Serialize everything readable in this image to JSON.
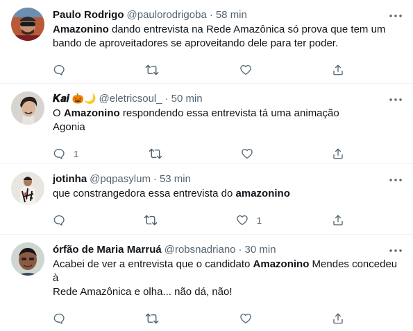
{
  "tweets": [
    {
      "name": "Paulo Rodrigo",
      "handle": "@paulorodrigoba",
      "separator": "·",
      "time": "58 min",
      "text_lines": [
        [
          {
            "t": "Amazonino",
            "b": true
          },
          {
            "t": " dando entrevista na Rede Amazônica só prova que tem um",
            "b": false
          }
        ],
        [
          {
            "t": "bando de aproveitadores se aproveitando dele para ter poder.",
            "b": false
          }
        ]
      ],
      "reply_count": "",
      "retweet_count": "",
      "like_count": ""
    },
    {
      "name": "𝑲𝒂𝒊",
      "name_emoji": "🎃🌙",
      "handle": "@eletricsoul_",
      "separator": "·",
      "time": "50 min",
      "text_lines": [
        [
          {
            "t": "O ",
            "b": false
          },
          {
            "t": "Amazonino",
            "b": true
          },
          {
            "t": " respondendo essa entrevista tá uma animação",
            "b": false
          }
        ],
        [
          {
            "t": "Agonia",
            "b": false
          }
        ]
      ],
      "reply_count": "1",
      "retweet_count": "",
      "like_count": ""
    },
    {
      "name": "jotinha",
      "handle": "@pqpasylum",
      "separator": "·",
      "time": "53 min",
      "text_lines": [
        [
          {
            "t": "que constrangedora essa entrevista do ",
            "b": false
          },
          {
            "t": "amazonino",
            "b": true
          }
        ]
      ],
      "reply_count": "",
      "retweet_count": "",
      "like_count": "1"
    },
    {
      "name": "órfão de Maria Marruá",
      "handle": "@robsnadriano",
      "separator": "·",
      "time": "30 min",
      "text_lines": [
        [
          {
            "t": "Acabei de ver a entrevista que o candidato ",
            "b": false
          },
          {
            "t": "Amazonino",
            "b": true
          },
          {
            "t": " Mendes concedeu à",
            "b": false
          }
        ],
        [
          {
            "t": "Rede Amazônica e olha... não dá, não!",
            "b": false
          }
        ]
      ],
      "reply_count": "",
      "retweet_count": "",
      "like_count": ""
    }
  ],
  "icons": {
    "more": "more-horizontal-icon",
    "reply": "reply-bubble-icon",
    "retweet": "retweet-icon",
    "like": "heart-icon",
    "share": "share-upload-icon"
  },
  "colors": {
    "text_primary": "#0f1419",
    "text_secondary": "#536471",
    "divider": "#eff3f4"
  }
}
